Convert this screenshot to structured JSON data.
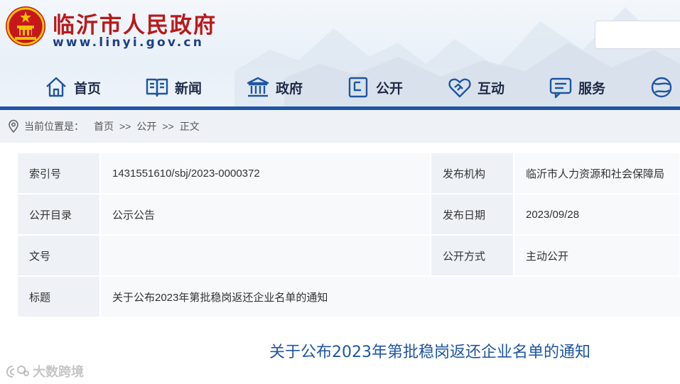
{
  "header": {
    "site_title": "临沂市人民政府",
    "site_url": "www.linyi.gov.cn",
    "search": {
      "placeholder": ""
    }
  },
  "nav": {
    "items": [
      {
        "label": "首页",
        "icon": "home-icon"
      },
      {
        "label": "新闻",
        "icon": "book-icon"
      },
      {
        "label": "政府",
        "icon": "government-building-icon"
      },
      {
        "label": "公开",
        "icon": "document-icon"
      },
      {
        "label": "互动",
        "icon": "handshake-heart-icon"
      },
      {
        "label": "服务",
        "icon": "message-list-icon"
      },
      {
        "label": "",
        "icon": "globe-icon"
      }
    ]
  },
  "breadcrumb": {
    "prefix": "当前位置是：",
    "items": [
      "首页",
      "公开",
      "正文"
    ],
    "separator": ">>"
  },
  "info": {
    "rows": [
      {
        "label1": "索引号",
        "value1": "1431551610/sbj/2023-0000372",
        "label2": "发布机构",
        "value2": "临沂市人力资源和社会保障局"
      },
      {
        "label1": "公开目录",
        "value1": "公示公告",
        "label2": "发布日期",
        "value2": "2023/09/28"
      },
      {
        "label1": "文号",
        "value1": "",
        "label2": "公开方式",
        "value2": "主动公开"
      }
    ],
    "title_row": {
      "label": "标题",
      "value": "关于公布2023年第批稳岗返还企业名单的通知"
    }
  },
  "article": {
    "title": "关于公布2023年第批稳岗返还企业名单的通知"
  },
  "watermark": {
    "text": "大数跨境"
  },
  "colors": {
    "brand_red": "#b8191a",
    "brand_blue": "#1e55a4",
    "url_blue": "#1e3f87"
  }
}
